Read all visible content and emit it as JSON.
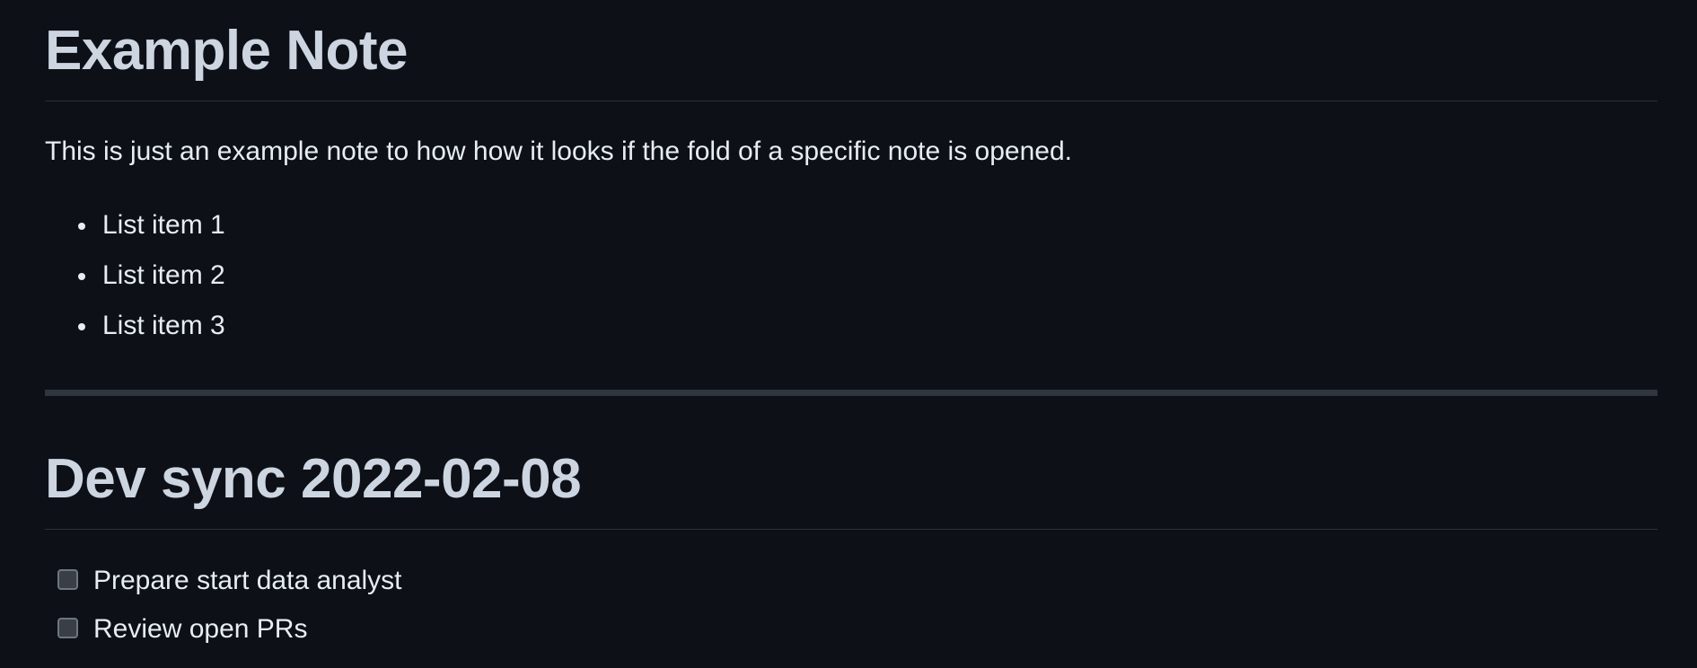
{
  "notes": [
    {
      "title": "Example Note",
      "paragraph": "This is just an example note to how how it looks if the fold of a specific note is opened.",
      "list_items": [
        "List item 1",
        "List item 2",
        "List item 3"
      ]
    },
    {
      "title": "Dev sync 2022-02-08",
      "tasks": [
        {
          "label": "Prepare start data analyst",
          "checked": false
        },
        {
          "label": "Review open PRs",
          "checked": false
        }
      ]
    }
  ],
  "colors": {
    "background": "#0d1117",
    "heading": "#ccd5e0",
    "text": "#e6edf3",
    "divider": "#30363d"
  }
}
